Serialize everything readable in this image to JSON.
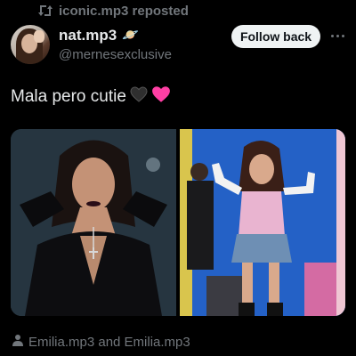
{
  "repost": {
    "text": "iconic.mp3 reposted",
    "icon": "repost-icon"
  },
  "author": {
    "display_name": "nat.mp3",
    "badge_emoji": "🪐",
    "handle": "@mernesexclusive",
    "avatar_icon": "avatar"
  },
  "actions": {
    "follow_label": "Follow back",
    "more_icon": "more-icon"
  },
  "post": {
    "text": "Mala pero cutie",
    "emoji_black_heart": "🖤",
    "emoji_pink_heart": "💗"
  },
  "media": {
    "images": [
      {
        "name": "photo-left",
        "description_icon": "image"
      },
      {
        "name": "photo-right",
        "description_icon": "image"
      }
    ]
  },
  "footer": {
    "tagged_text": "Emilia.mp3 and Emilia.mp3",
    "icon": "person-icon"
  },
  "colors": {
    "background": "#000000",
    "text_primary": "#e7e9ea",
    "text_secondary": "#71767b",
    "button_bg": "#eff3f4",
    "button_text": "#0f1419",
    "heart_pink": "#ff3fa4"
  }
}
